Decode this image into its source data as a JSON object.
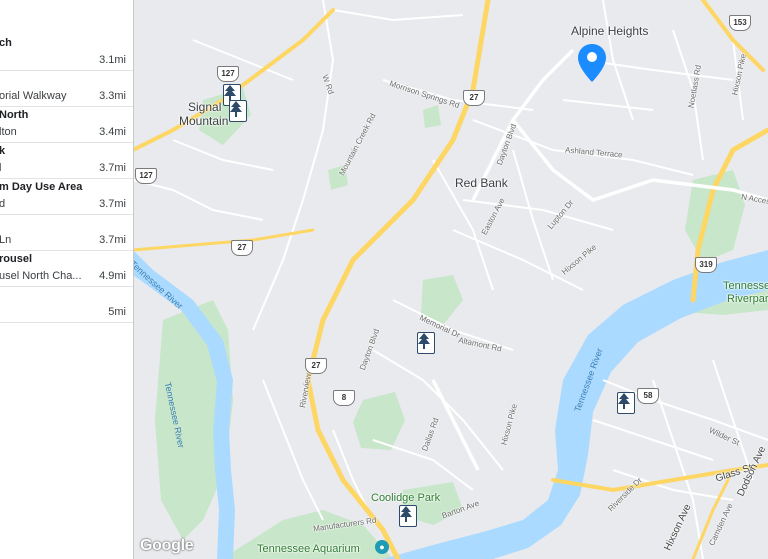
{
  "results": [
    {
      "name": "ch",
      "addr": "",
      "dist": "3.1mi"
    },
    {
      "name": "",
      "addr": "orial Walkway",
      "dist": "3.3mi"
    },
    {
      "name": "North",
      "addr": "lton",
      "dist": "3.4mi"
    },
    {
      "name": "k",
      "addr": "l",
      "dist": "3.7mi"
    },
    {
      "name": "m Day Use Area",
      "addr": "d",
      "dist": "3.7mi"
    },
    {
      "name": "",
      "addr": "Ln",
      "dist": "3.7mi"
    },
    {
      "name": "rousel",
      "addr": "usel North Cha...",
      "dist": "4.9mi"
    },
    {
      "name": "",
      "addr": "",
      "dist": "5mi"
    }
  ],
  "places": {
    "alpine_heights": "Alpine Heights",
    "signal_mountain_1": "Signal",
    "signal_mountain_2": "Mountain",
    "red_bank": "Red Bank",
    "coolidge_park": "Coolidge Park",
    "tennessee_aquarium": "Tennessee Aquarium",
    "tennessee_riverpark_1": "Tennessee",
    "tennessee_riverpark_2": "Riverpark"
  },
  "streets": {
    "w_rd": "W Rd",
    "morrison_springs": "Morrison Springs Rd",
    "mountain_creek": "Mountain Creek Rd",
    "dayton_blvd_n": "Dayton Blvd",
    "ashland_terrace": "Ashland Terrace",
    "n_access": "N Access",
    "easton_ave": "Easton Ave",
    "lupton_dr": "Lupton Dr",
    "hixson_pike_1": "Hixson Pike",
    "hixson_pike_2": "Hixson Pike",
    "hixson_pike_3": "Hixson Pike",
    "memorial_dr": "Memorial Dr",
    "altamont_rd": "Altamont Rd",
    "dayton_blvd_s": "Dayton Blvd",
    "dallas_rd": "Dallas Rd",
    "riverview_rd": "Riverview Rd",
    "barton_ave": "Barton Ave",
    "manufacturers_rd": "Manufacturers Rd",
    "riverside_dr": "Riverside Dr",
    "wilder_st": "Wilder St",
    "glass_st": "Glass St",
    "hixson_ave": "Hixson Ave",
    "camden_ave": "Camden Ave",
    "dodson_ave": "Dodson Ave",
    "noetlass_rd": "Noetlass Rd",
    "hixson_pike_ne": "Hixson Pike"
  },
  "rivers": {
    "west_upper": "Tennessee River",
    "west_lower": "Tennessee River",
    "east": "Tennessee River"
  },
  "shields": {
    "r127_top": "127",
    "r127_left": "127",
    "r27_top": "27",
    "r27_mid": "27",
    "r27_south": "27",
    "r153": "153",
    "r319": "319",
    "r58": "58",
    "r8": "8"
  },
  "google_logo": "Google",
  "colors": {
    "water": "#aadaff",
    "park": "#c8e6c9",
    "highway": "#fdd663",
    "pin": "#1a8cff",
    "marker_tree": "#2d4a6b"
  }
}
